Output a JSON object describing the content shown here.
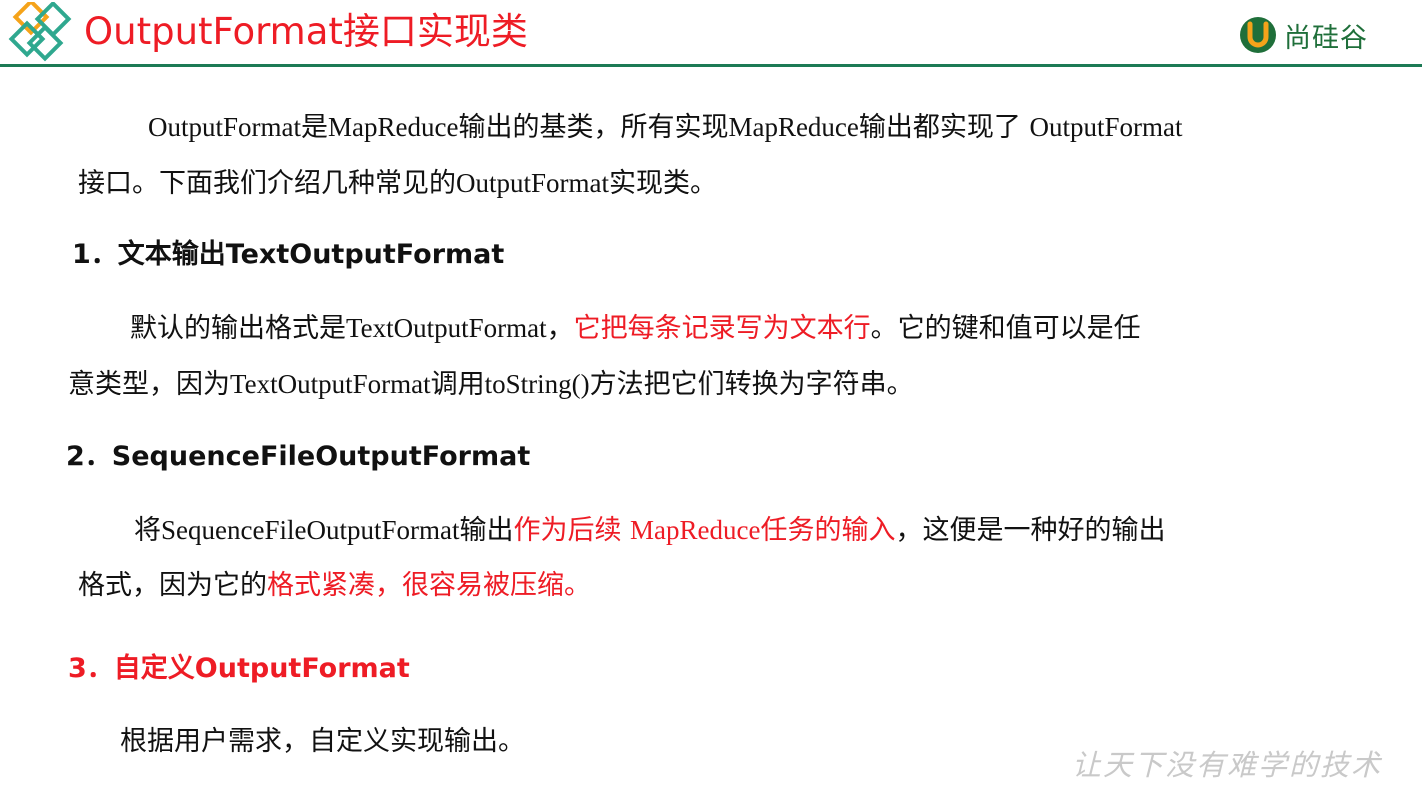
{
  "header": {
    "title": "OutputFormat接口实现类",
    "brand": "尚硅谷"
  },
  "intro": {
    "line1": {
      "a": "OutputFormat",
      "b": "是",
      "c": "MapReduce",
      "d": "输出的基类，所有实现",
      "e": "MapReduce",
      "f": "输出都实现了 ",
      "g": "OutputFormat"
    },
    "line2": {
      "a": "接口。下面我们介绍几种常见的",
      "b": "OutputFormat",
      "c": "实现类。"
    }
  },
  "section1": {
    "heading": "1．文本输出TextOutputFormat",
    "line1": {
      "a": "默认的输出格式是",
      "b": "TextOutputFormat",
      "c": "，",
      "d": "它把每条记录写为文本行",
      "e": "。它的键和值可以是任"
    },
    "line2": {
      "a": "意类型，因为",
      "b": "TextOutputFormat",
      "c": "调用",
      "d": "toString()",
      "e": "方法把它们转换为字符串。"
    }
  },
  "section2": {
    "heading": "2．SequenceFileOutputFormat",
    "line1": {
      "a": "将",
      "b": "SequenceFileOutputFormat",
      "c": "输出",
      "d": "作为后续 ",
      "e": "MapReduce",
      "f": "任务的输入",
      "g": "，这便是一种好的输出"
    },
    "line2": {
      "a": "格式，因为它的",
      "b": "格式紧凑，很容易被压缩。"
    }
  },
  "section3": {
    "heading": "3．自定义OutputFormat",
    "line1": "根据用户需求，自定义实现输出。"
  },
  "footer": {
    "slogan": "让天下没有难学的技术"
  },
  "colors": {
    "title": "#ee1c25",
    "highlight": "#ee1c25",
    "rule": "#1c7a55",
    "brand": "#1f6f3a"
  },
  "icons": [
    "diamond-logo-icon",
    "u-logo-icon"
  ]
}
